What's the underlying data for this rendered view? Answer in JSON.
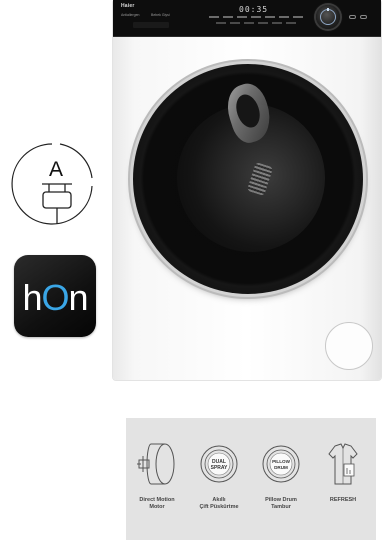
{
  "machine": {
    "brand": "Haier",
    "panel_text_left": "Antiallergen",
    "panel_text_mid": "Bebek Giysi",
    "display_time": "00:35",
    "colors": {
      "body": "#ffffff",
      "panel": "#0d0d0d",
      "door": "#0b0b0b",
      "knob_accent": "#8fa7c5"
    }
  },
  "energy_class": {
    "letter": "A",
    "icon": "plug-icon"
  },
  "app": {
    "name_left": "h",
    "name_o": "O",
    "name_right": "n",
    "accent": "#3aa6e6"
  },
  "features": [
    {
      "icon": "direct-motion-motor-icon",
      "line1": "Direct Motion",
      "line2": "Motor"
    },
    {
      "icon": "dual-spray-icon",
      "badge_top": "DUAL",
      "badge_bottom": "SPRAY",
      "line1": "Akıllı",
      "line2": "Çift Püskürtme"
    },
    {
      "icon": "pillow-drum-icon",
      "badge_top": "PILLOW",
      "badge_bottom": "DRUM",
      "line1": "Pillow Drum",
      "line2": "Tambur"
    },
    {
      "icon": "refresh-shirt-icon",
      "line1": "REFRESH",
      "line2": ""
    }
  ]
}
